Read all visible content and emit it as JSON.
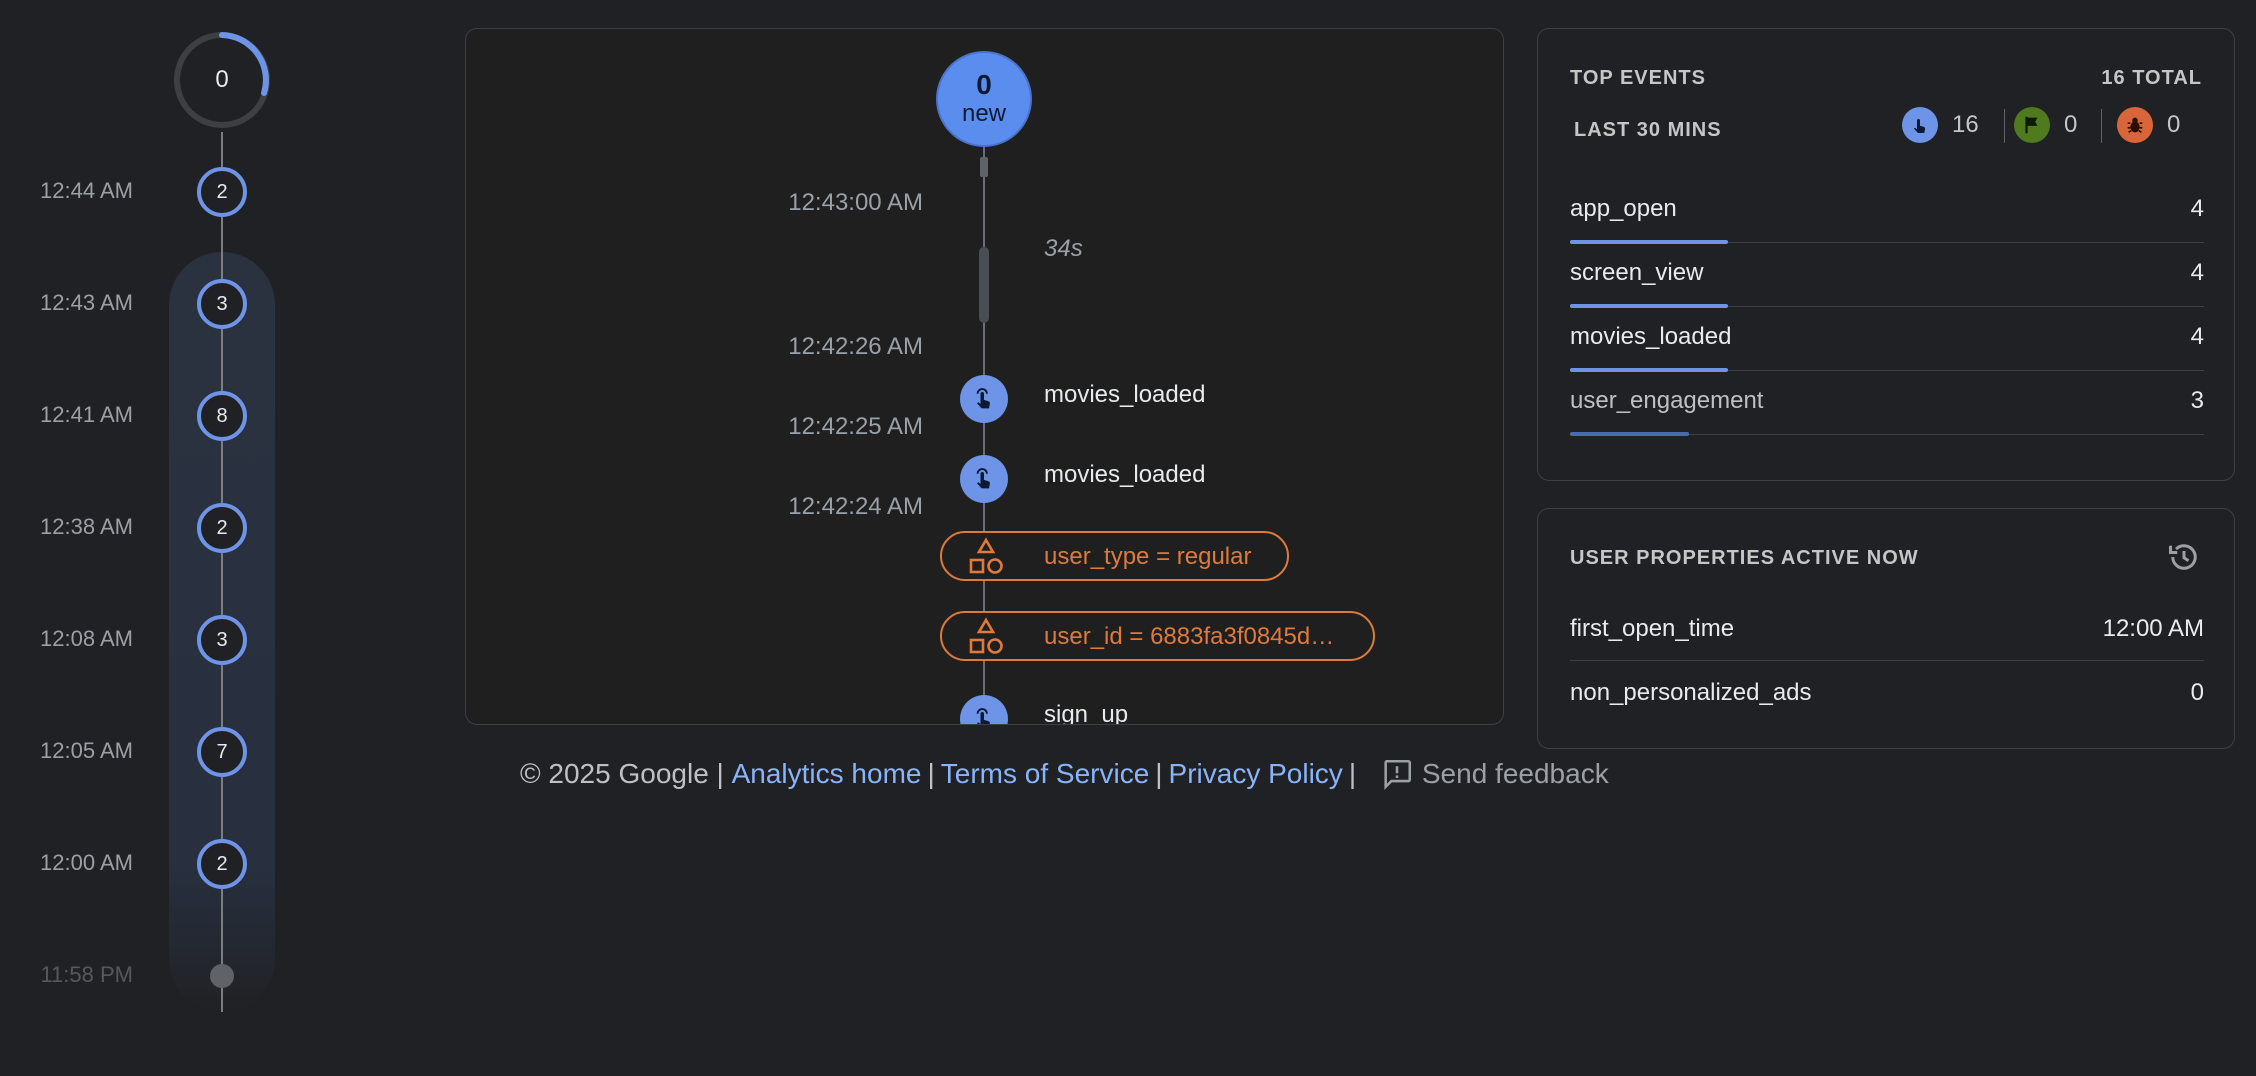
{
  "minute_timeline": {
    "current_count": "0",
    "items": [
      {
        "time": "12:44 AM",
        "count": "2"
      },
      {
        "time": "12:43 AM",
        "count": "3"
      },
      {
        "time": "12:41 AM",
        "count": "8"
      },
      {
        "time": "12:38 AM",
        "count": "2"
      },
      {
        "time": "12:08 AM",
        "count": "3"
      },
      {
        "time": "12:05 AM",
        "count": "7"
      },
      {
        "time": "12:00 AM",
        "count": "2"
      }
    ],
    "last_time": "11:58 PM"
  },
  "stream": {
    "new_count": "0",
    "new_label": "new",
    "gap_label": "34s",
    "timestamps": [
      "12:43:00 AM",
      "12:42:26 AM",
      "12:42:25 AM",
      "12:42:24 AM"
    ],
    "events": [
      {
        "label": "movies_loaded",
        "kind": "event"
      },
      {
        "label": "movies_loaded",
        "kind": "event"
      },
      {
        "label": "user_type = regular",
        "kind": "user_property"
      },
      {
        "label": "user_id = 6883fa3f0845d…",
        "kind": "user_property"
      },
      {
        "label": "sign_up",
        "kind": "event"
      }
    ]
  },
  "footer": {
    "copyright": "© 2025 Google |",
    "links": [
      "Analytics home",
      "Terms of Service",
      "Privacy Policy"
    ],
    "separator": "|",
    "feedback": "Send feedback"
  },
  "top_events": {
    "title": "TOP EVENTS",
    "total": "16 TOTAL",
    "period": "LAST 30 MINS",
    "stats": {
      "events": "16",
      "conversions": "0",
      "errors": "0"
    },
    "rows": [
      {
        "name": "app_open",
        "count": "4",
        "share": 1.0
      },
      {
        "name": "screen_view",
        "count": "4",
        "share": 1.0
      },
      {
        "name": "movies_loaded",
        "count": "4",
        "share": 1.0
      },
      {
        "name": "user_engagement",
        "count": "3",
        "share": 0.75
      }
    ]
  },
  "user_properties": {
    "title": "USER PROPERTIES ACTIVE NOW",
    "rows": [
      {
        "name": "first_open_time",
        "value": "12:00 AM"
      },
      {
        "name": "non_personalized_ads",
        "value": "0"
      }
    ]
  },
  "colors": {
    "accent": "#6d94e6",
    "property": "#e07a3c",
    "conversion": "#4f7a1e",
    "error": "#d9653b",
    "link": "#8ab4f8"
  },
  "icons": [
    "touch-icon",
    "shapes-icon",
    "flag-icon",
    "bug-icon",
    "history-icon",
    "feedback-icon"
  ]
}
